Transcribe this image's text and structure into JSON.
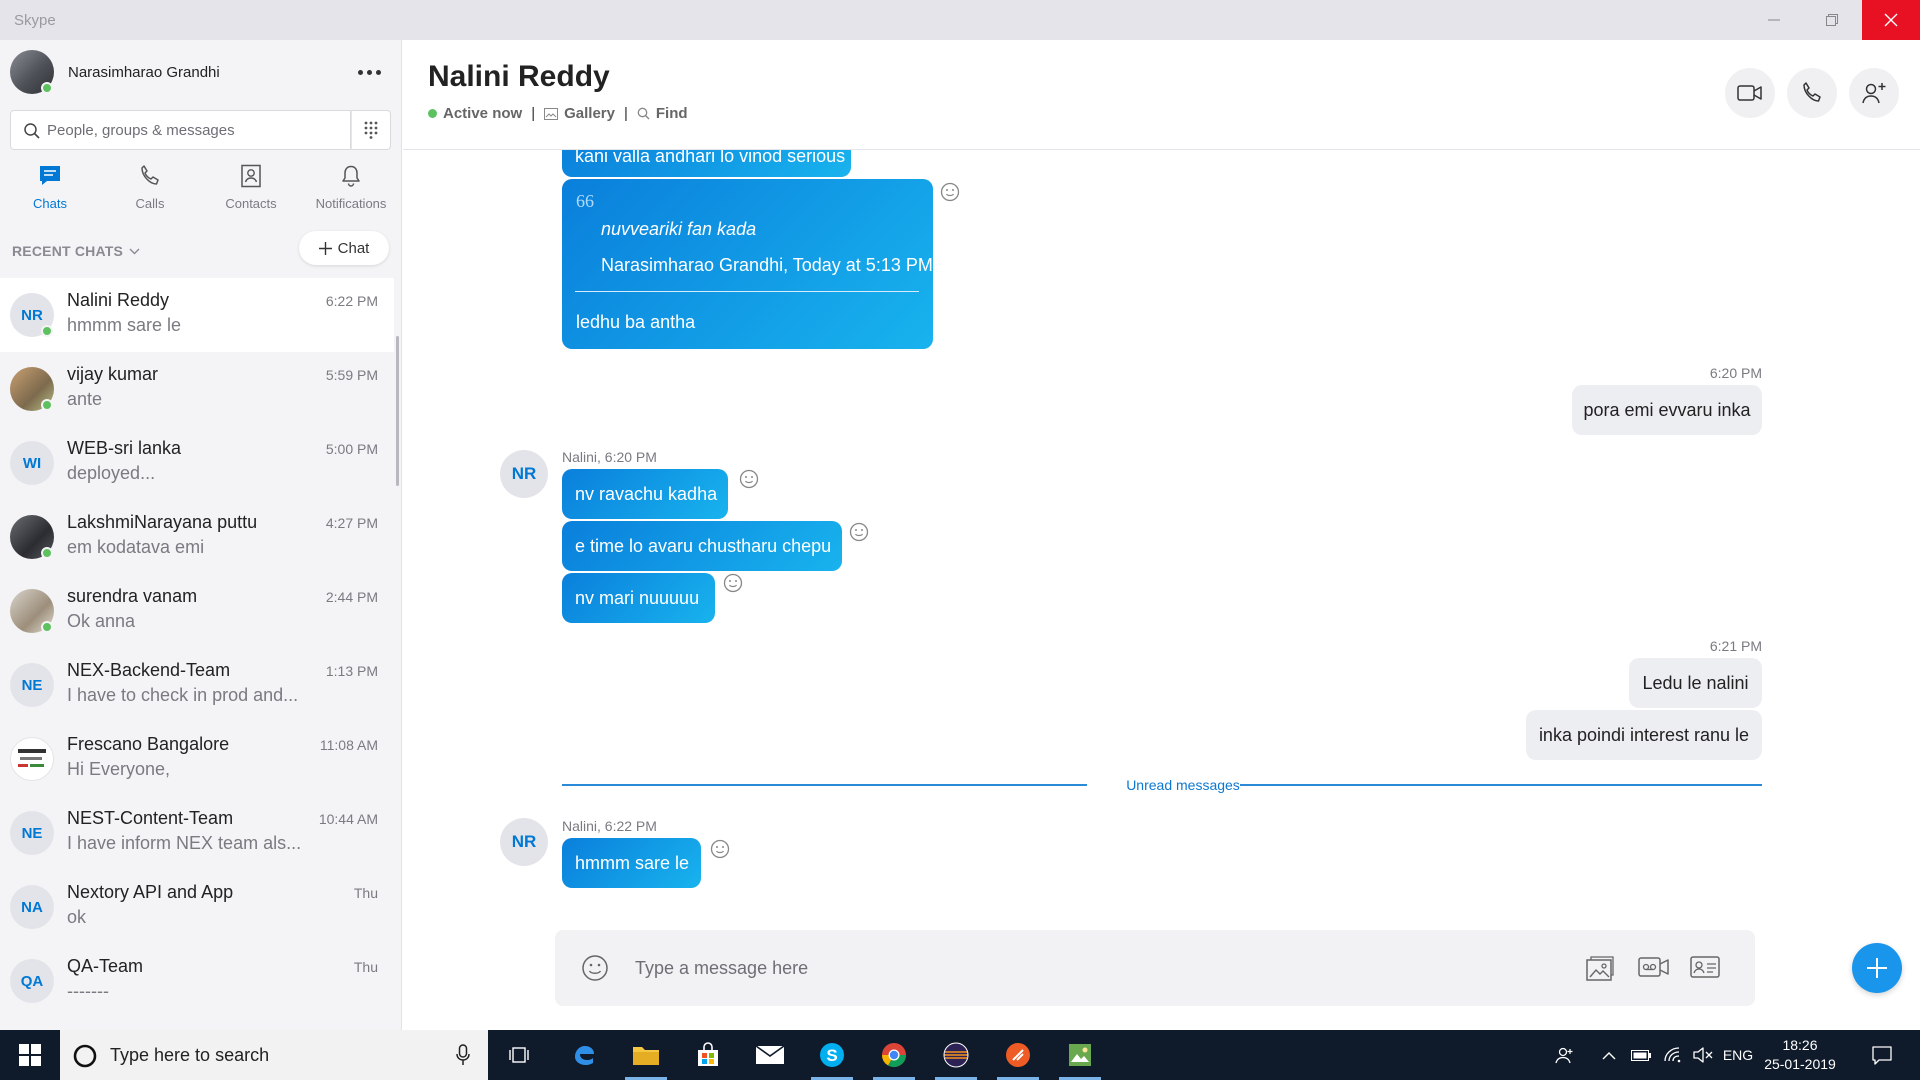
{
  "window": {
    "title": "Skype"
  },
  "profile": {
    "name": "Narasimharao Grandhi"
  },
  "search": {
    "placeholder": "People, groups & messages"
  },
  "nav_tabs": [
    {
      "label": "Chats",
      "icon": "chat-icon",
      "active": true
    },
    {
      "label": "Calls",
      "icon": "phone-icon"
    },
    {
      "label": "Contacts",
      "icon": "contacts-icon"
    },
    {
      "label": "Notifications",
      "icon": "bell-icon"
    }
  ],
  "recent": {
    "header": "RECENT CHATS",
    "new_chat_label": "Chat"
  },
  "chats": [
    {
      "name": "Nalini Reddy",
      "preview": "hmmm sare le",
      "time": "6:22 PM",
      "initials": "NR",
      "online": true,
      "active": true
    },
    {
      "name": "vijay kumar",
      "preview": "ante",
      "time": "5:59 PM",
      "initials": "",
      "online": true
    },
    {
      "name": "WEB-sri lanka",
      "preview": "deployed...",
      "time": "5:00 PM",
      "initials": "WI"
    },
    {
      "name": "LakshmiNarayana puttu",
      "preview": "em kodatava emi",
      "time": "4:27 PM",
      "initials": "",
      "online": true
    },
    {
      "name": "surendra vanam",
      "preview": "Ok anna",
      "time": "2:44 PM",
      "initials": "",
      "online": true
    },
    {
      "name": "NEX-Backend-Team",
      "preview": "I have to check in prod and...",
      "time": "1:13 PM",
      "initials": "NE"
    },
    {
      "name": "Frescano Bangalore",
      "preview": "Hi Everyone,",
      "time": "11:08 AM",
      "initials": ""
    },
    {
      "name": "NEST-Content-Team",
      "preview": "I have inform NEX team als...",
      "time": "10:44 AM",
      "initials": "NE"
    },
    {
      "name": "Nextory API and App",
      "preview": "ok",
      "time": "Thu",
      "initials": "NA"
    },
    {
      "name": "QA-Team",
      "preview": "-------",
      "time": "Thu",
      "initials": "QA"
    }
  ],
  "conversation": {
    "title": "Nalini Reddy",
    "status": "Active now",
    "gallery": "Gallery",
    "find": "Find",
    "partial_message": "kani valla andhari lo vinod serious",
    "quote": {
      "mark": "66",
      "text": "nuvveariki fan kada",
      "attribution": "Narasimharao Grandhi, Today at 5:13 PM",
      "reply": "ledhu ba antha"
    },
    "out_time_1": "6:20 PM",
    "out_msg_1": "pora emi evvaru inka",
    "in_meta_1": "Nalini, 6:20 PM",
    "in_avatar": "NR",
    "in_msgs_1": [
      "nv ravachu kadha",
      "e time lo avaru chustharu chepu",
      "nv mari nuuuuu"
    ],
    "out_time_2": "6:21 PM",
    "out_msgs_2": [
      "Ledu le nalini",
      "inka poindi interest ranu le"
    ],
    "unread_label": "Unread messages",
    "in_meta_2": "Nalini, 6:22 PM",
    "in_msg_2": "hmmm sare le"
  },
  "composer": {
    "placeholder": "Type a message here"
  },
  "taskbar": {
    "search_placeholder": "Type here to search",
    "lang": "ENG",
    "time": "18:26",
    "date": "25-01-2019"
  },
  "colors": {
    "accent": "#0078d4",
    "online": "#5dc15f",
    "bubble_in": "#0a7fdb",
    "close_red": "#e81123"
  }
}
